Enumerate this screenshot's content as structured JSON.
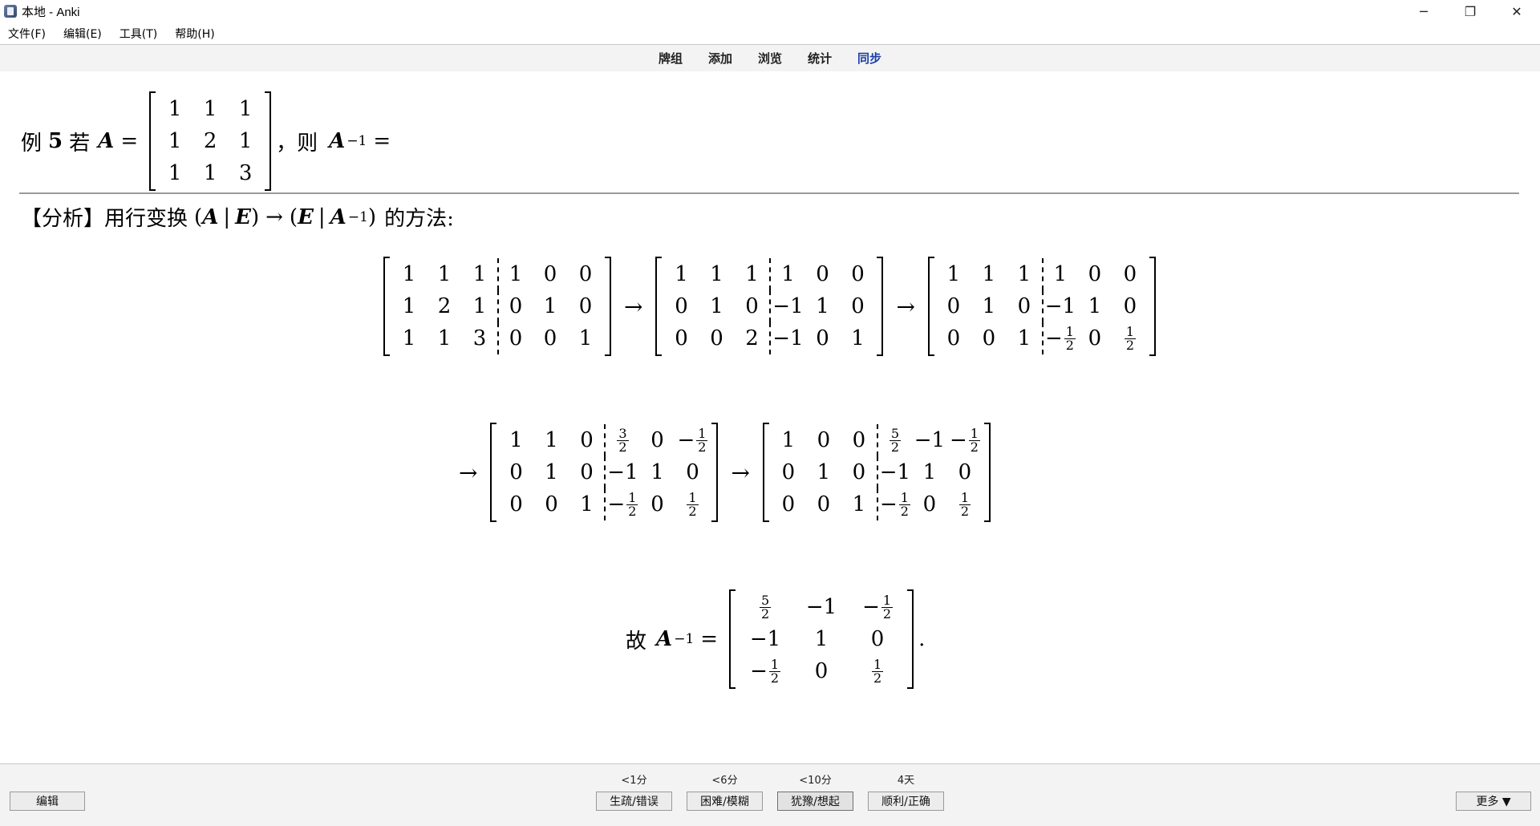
{
  "window": {
    "title": "本地 - Anki",
    "minimize": "─",
    "restore": "❐",
    "close": "✕"
  },
  "menu": [
    "文件(F)",
    "编辑(E)",
    "工具(T)",
    "帮助(H)"
  ],
  "toolbar": {
    "decks": "牌组",
    "add": "添加",
    "browse": "浏览",
    "stats": "统计",
    "sync": "同步"
  },
  "question": {
    "prefix": "例",
    "num": "5",
    "if": "若",
    "A": "A",
    "eq": "=",
    "then": "，则",
    "inv_sup": "−1",
    "matrix": [
      [
        "1",
        "1",
        "1"
      ],
      [
        "1",
        "2",
        "1"
      ],
      [
        "1",
        "1",
        "3"
      ]
    ]
  },
  "analysis": {
    "bracket_label": "【分析】",
    "text": "用行变换",
    "E": "E",
    "A": "A",
    "bar": "|",
    "to": "→",
    "method": "的方法:"
  },
  "steps_row1": {
    "m1": [
      [
        "1",
        "1",
        "1",
        "1",
        "0",
        "0"
      ],
      [
        "1",
        "2",
        "1",
        "0",
        "1",
        "0"
      ],
      [
        "1",
        "1",
        "3",
        "0",
        "0",
        "1"
      ]
    ],
    "m2": [
      [
        "1",
        "1",
        "1",
        "1",
        "0",
        "0"
      ],
      [
        "0",
        "1",
        "0",
        "−1",
        "1",
        "0"
      ],
      [
        "0",
        "0",
        "2",
        "−1",
        "0",
        "1"
      ]
    ],
    "m3": [
      [
        "1",
        "1",
        "1",
        "1",
        "0",
        "0"
      ],
      [
        "0",
        "1",
        "0",
        "−1",
        "1",
        "0"
      ],
      [
        "0",
        "0",
        "1",
        "−1/2",
        "0",
        "1/2"
      ]
    ]
  },
  "steps_row2": {
    "m4": [
      [
        "1",
        "1",
        "0",
        "3/2",
        "0",
        "−1/2"
      ],
      [
        "0",
        "1",
        "0",
        "−1",
        "1",
        "0"
      ],
      [
        "0",
        "0",
        "1",
        "−1/2",
        "0",
        "1/2"
      ]
    ],
    "m5": [
      [
        "1",
        "0",
        "0",
        "5/2",
        "−1",
        "−1/2"
      ],
      [
        "0",
        "1",
        "0",
        "−1",
        "1",
        "0"
      ],
      [
        "0",
        "0",
        "1",
        "−1/2",
        "0",
        "1/2"
      ]
    ]
  },
  "result": {
    "prefix": "故",
    "A": "A",
    "eq": "=",
    "period": ".",
    "matrix": [
      [
        "5/2",
        "−1",
        "−1/2"
      ],
      [
        "−1",
        "1",
        "0"
      ],
      [
        "−1/2",
        "0",
        "1/2"
      ]
    ]
  },
  "bottom": {
    "edit": "编辑",
    "more": "更多 ▼",
    "answers": [
      {
        "interval": "<1分",
        "label": "生疏/错误"
      },
      {
        "interval": "<6分",
        "label": "困难/模糊"
      },
      {
        "interval": "<10分",
        "label": "犹豫/想起"
      },
      {
        "interval": "4天",
        "label": "顺利/正确"
      }
    ]
  }
}
